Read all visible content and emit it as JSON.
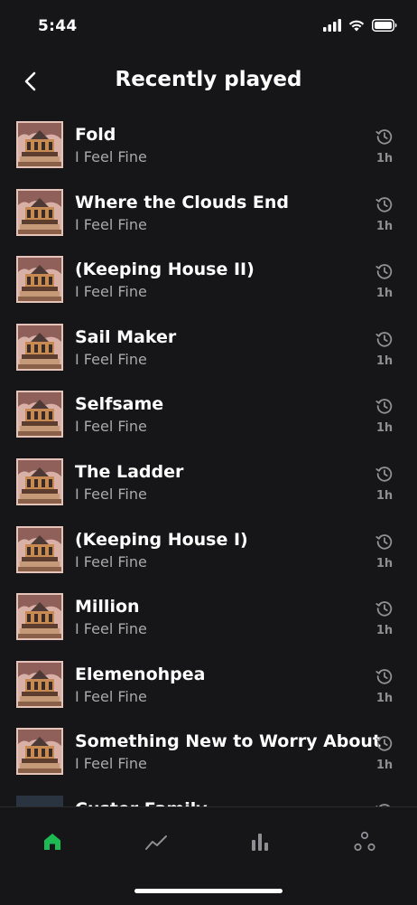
{
  "status_bar": {
    "time": "5:44"
  },
  "header": {
    "title": "Recently played",
    "back_icon": "chevron-left-icon"
  },
  "tracks": [
    {
      "title": "Fold",
      "artist": "I Feel Fine",
      "time_ago": "1h"
    },
    {
      "title": "Where the Clouds End",
      "artist": "I Feel Fine",
      "time_ago": "1h"
    },
    {
      "title": "(Keeping House II)",
      "artist": "I Feel Fine",
      "time_ago": "1h"
    },
    {
      "title": "Sail Maker",
      "artist": "I Feel Fine",
      "time_ago": "1h"
    },
    {
      "title": "Selfsame",
      "artist": "I Feel Fine",
      "time_ago": "1h"
    },
    {
      "title": "The Ladder",
      "artist": "I Feel Fine",
      "time_ago": "1h"
    },
    {
      "title": "(Keeping House I)",
      "artist": "I Feel Fine",
      "time_ago": "1h"
    },
    {
      "title": "Million",
      "artist": "I Feel Fine",
      "time_ago": "1h"
    },
    {
      "title": "Elemenohpea",
      "artist": "I Feel Fine",
      "time_ago": "1h"
    },
    {
      "title": "Something New to Worry About",
      "artist": "I Feel Fine",
      "time_ago": "1h"
    },
    {
      "title": "Custer Family",
      "artist": "",
      "time_ago": ""
    }
  ],
  "tab_bar": {
    "tabs": [
      {
        "icon": "home-icon",
        "active": true
      },
      {
        "icon": "trend-icon",
        "active": false
      },
      {
        "icon": "bar-chart-icon",
        "active": false
      },
      {
        "icon": "nodes-icon",
        "active": false
      }
    ],
    "active_color": "#1db954",
    "inactive_color": "#8e8e93"
  }
}
